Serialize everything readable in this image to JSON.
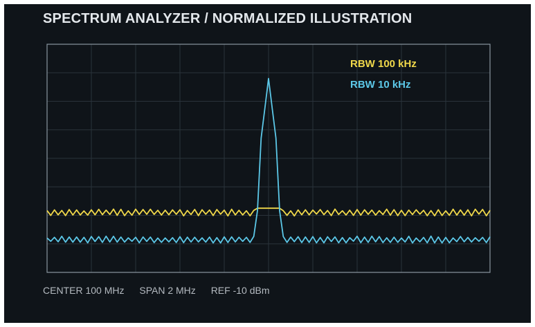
{
  "chart_data": {
    "type": "line",
    "title": "SPECTRUM ANALYZER / NORMALIZED ILLUSTRATION",
    "xlabel": "",
    "ylabel": "",
    "xlim": [
      -1,
      1
    ],
    "ylim": [
      0,
      8
    ],
    "grid": true,
    "legend_position": "top-right",
    "series": [
      {
        "name": "RBW 100 kHz",
        "color": "#f0d84a",
        "noise_floor": 2.1,
        "noise_amplitude": 0.12
      },
      {
        "name": "RBW 10 kHz",
        "color": "#5cc8e8",
        "noise_floor": 1.15,
        "noise_amplitude": 0.12,
        "peak": {
          "x": 0.0,
          "y": 6.8
        }
      }
    ]
  },
  "footer": {
    "center": "CENTER 100 MHz",
    "span": "SPAN 2 MHz",
    "ref": "REF -10 dBm"
  }
}
